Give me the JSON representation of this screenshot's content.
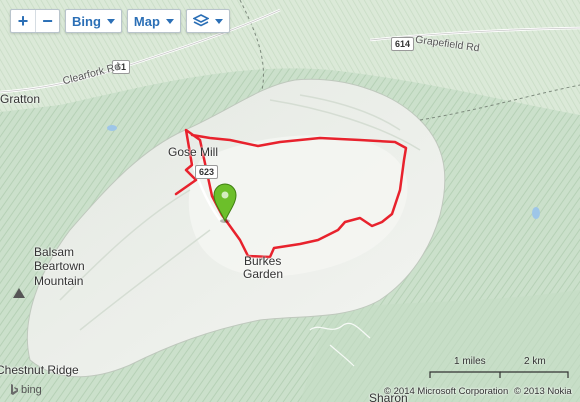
{
  "toolbar": {
    "zoom_in": "+",
    "zoom_out": "−",
    "imagery_source": "Bing",
    "map_style": "Map"
  },
  "labels": {
    "gose_mill": "Gose Mill",
    "burkes_garden_1": "Burkes",
    "burkes_garden_2": "Garden",
    "balsam": "Balsam",
    "beartown": "Beartown",
    "mountain": "Mountain",
    "clearfork_rd": "Clearfork Rd",
    "grapefield_rd": "Grapefield Rd",
    "gratton": "Gratton",
    "chestnut_ridge": "Chestnut Ridge",
    "sharon": "Sharon"
  },
  "shields": {
    "route_61": "61",
    "route_614": "614",
    "route_623": "623"
  },
  "scale": {
    "miles": "1 miles",
    "km": "2 km"
  },
  "copyright": {
    "microsoft": "© 2014 Microsoft Corporation",
    "nokia": "© 2013 Nokia"
  },
  "branding": {
    "logo_text": "bing"
  },
  "colors": {
    "route": "#e8222d",
    "pin": "#6cbf2a",
    "valley": "#eef0ec",
    "forest": "#cfe3cf"
  }
}
